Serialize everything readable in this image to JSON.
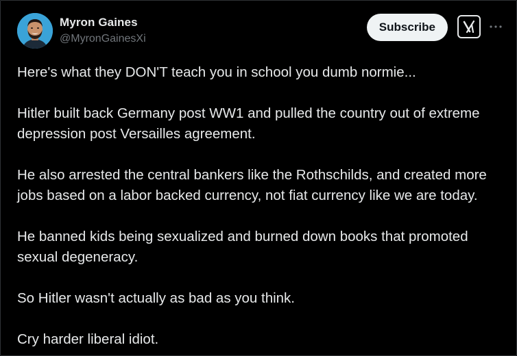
{
  "author": {
    "display_name": "Myron Gaines",
    "handle": "@MyronGainesXi",
    "avatar_icon": "avatar-image"
  },
  "actions": {
    "subscribe_label": "Subscribe",
    "grok_icon": "grok-icon",
    "more_icon": "more-icon"
  },
  "tweet": {
    "paragraphs": [
      "Here's what they DON'T teach you in school you dumb normie...",
      "Hitler built back Germany post WW1 and pulled the country out of extreme depression post Versailles agreement.",
      "He also arrested the central bankers like the Rothschilds, and created more jobs based on a labor backed currency, not fiat currency like we are today.",
      "He banned kids being sexualized and burned down books that promoted sexual degeneracy.",
      "So Hitler wasn't actually as bad as you think.",
      "Cry harder liberal idiot."
    ]
  },
  "colors": {
    "background": "#000000",
    "text_primary": "#e7e9ea",
    "text_secondary": "#71767b",
    "button_bg": "#eff3f4",
    "button_text": "#0f1419"
  }
}
